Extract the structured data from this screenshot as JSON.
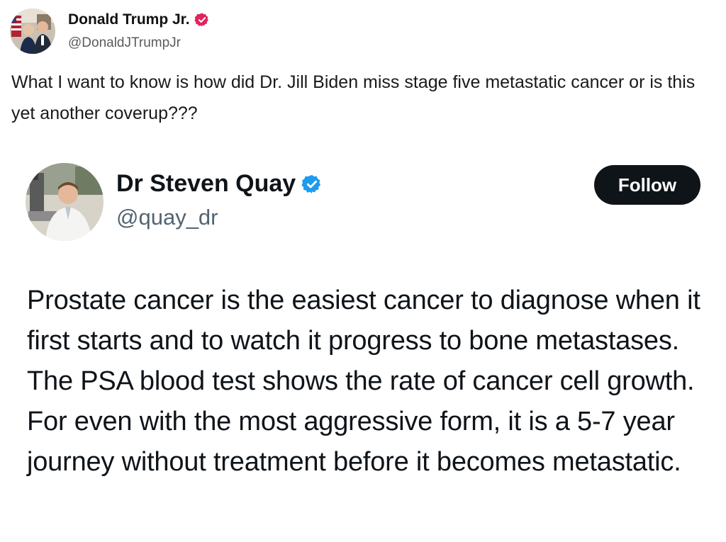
{
  "post": {
    "author": {
      "display_name": "Donald Trump Jr.",
      "handle": "@DonaldJTrumpJr",
      "verified_badge_icon": "verified-badge-icon",
      "badge_color": "#e0245e"
    },
    "text": "What I want to know is how did Dr. Jill Biden miss stage five metastatic cancer or is this yet another coverup???"
  },
  "quoted": {
    "author": {
      "display_name": "Dr Steven Quay",
      "handle": "@quay_dr",
      "verified_badge_icon": "verified-badge-icon",
      "badge_color": "#1d9bf0"
    },
    "follow_label": "Follow",
    "text": "Prostate cancer is the easiest cancer to diagnose when it first starts and to watch it progress to bone metastases. The PSA blood test shows the rate of cancer cell growth. For even with the most aggressive form, it is a 5-7 year journey without treatment before it becomes metastatic."
  }
}
